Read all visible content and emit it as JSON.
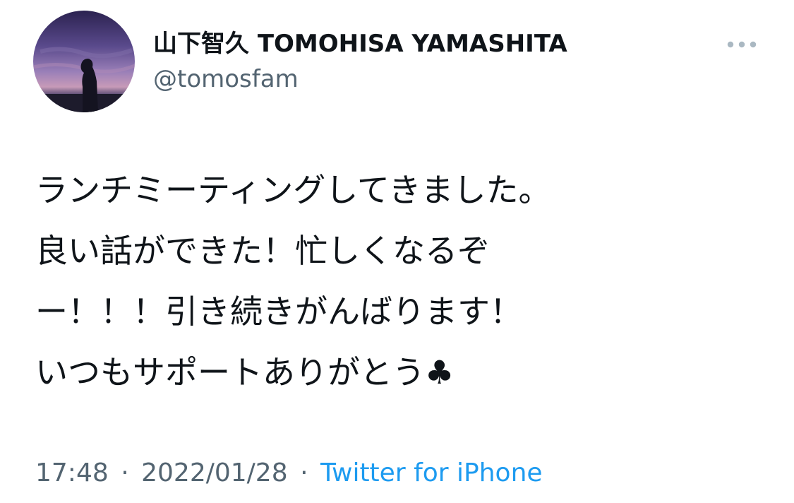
{
  "tweet": {
    "author": {
      "display_name": "山下智久 TOMOHISA YAMASHITA",
      "handle": "@tomosfam"
    },
    "text_lines": [
      "ランチミーティングしてきました。",
      "良い話ができた！忙しくなるぞ",
      "ー！！！引き続きがんばります！",
      "いつもサポートありがとう♣"
    ],
    "time": "17:48",
    "date": "2022/01/28",
    "separator": "·",
    "source": "Twitter for iPhone"
  },
  "colors": {
    "text_primary": "#0f1419",
    "text_secondary": "#536471",
    "link": "#1d9bf0",
    "more_dots": "#aab8c2"
  },
  "icons": {
    "more": "more-horizontal-icon",
    "avatar": "profile-photo"
  }
}
